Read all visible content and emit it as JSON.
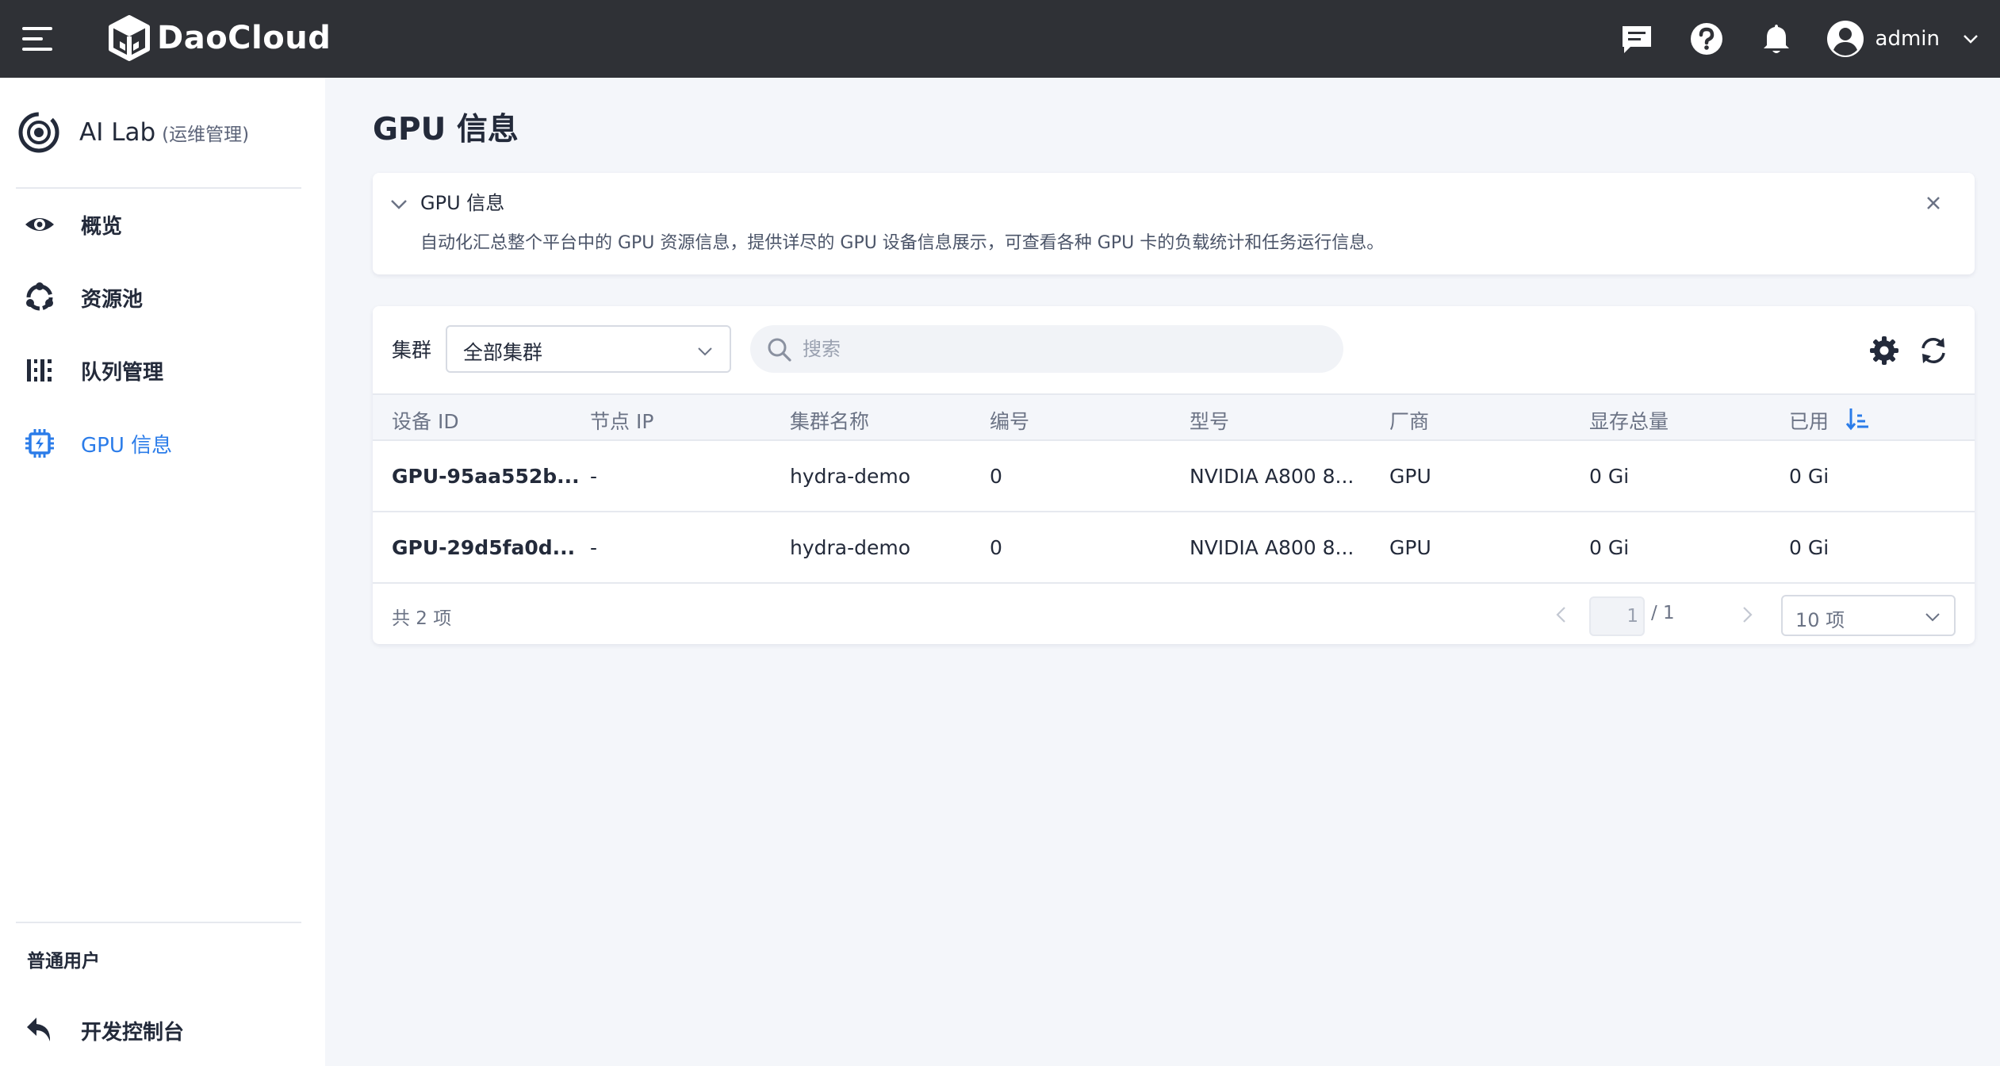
{
  "header": {
    "brand": "DaoCloud",
    "user_name": "admin"
  },
  "sidebar": {
    "module_title": "AI Lab",
    "module_subtitle": "(运维管理)",
    "items": [
      {
        "label": "概览"
      },
      {
        "label": "资源池"
      },
      {
        "label": "队列管理"
      },
      {
        "label": "GPU 信息"
      }
    ],
    "section_label": "普通用户",
    "bottom_item": "开发控制台"
  },
  "page": {
    "title": "GPU 信息"
  },
  "banner": {
    "title": "GPU 信息",
    "description": "自动化汇总整个平台中的 GPU 资源信息，提供详尽的 GPU 设备信息展示，可查看各种 GPU 卡的负载统计和任务运行信息。"
  },
  "filter": {
    "cluster_label": "集群",
    "cluster_value": "全部集群",
    "search_placeholder": "搜索"
  },
  "table": {
    "columns": [
      "设备 ID",
      "节点 IP",
      "集群名称",
      "编号",
      "型号",
      "厂商",
      "显存总量",
      "已用"
    ],
    "rows": [
      [
        "GPU-95aa552b...",
        "-",
        "hydra-demo",
        "0",
        "NVIDIA A800 8...",
        "GPU",
        "0 Gi",
        "0 Gi"
      ],
      [
        "GPU-29d5fa0d...",
        "-",
        "hydra-demo",
        "0",
        "NVIDIA A800 8...",
        "GPU",
        "0 Gi",
        "0 Gi"
      ]
    ]
  },
  "pagination": {
    "total_text": "共 2 项",
    "current_page": "1",
    "total_pages": "/ 1",
    "page_size": "10 项"
  },
  "colors": {
    "topbar": "#2f3136",
    "accent": "#2b7ce9",
    "text": "#232a3a",
    "muted": "#6b7385"
  }
}
